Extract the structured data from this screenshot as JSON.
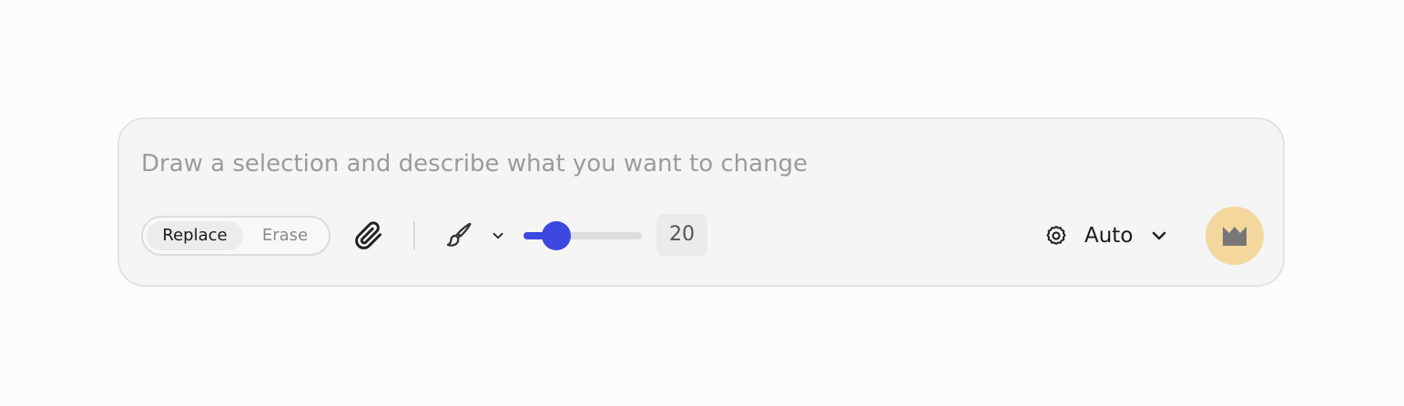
{
  "prompt": {
    "placeholder": "Draw a selection and describe what you want to change",
    "value": ""
  },
  "mode": {
    "options": [
      "Replace",
      "Erase"
    ],
    "selected": "Replace"
  },
  "brush": {
    "size": "20",
    "slider_fraction": 0.2
  },
  "model": {
    "selected": "Auto"
  },
  "icons": {
    "attach": "paperclip-icon",
    "brush": "brush-icon",
    "brush_dropdown": "chevron-down-icon",
    "settings": "gear-icon",
    "model_dropdown": "chevron-down-icon",
    "submit": "crown-icon"
  },
  "colors": {
    "accent": "#3d48e0",
    "submit_bg": "#f4d79c",
    "submit_icon": "#777777"
  }
}
